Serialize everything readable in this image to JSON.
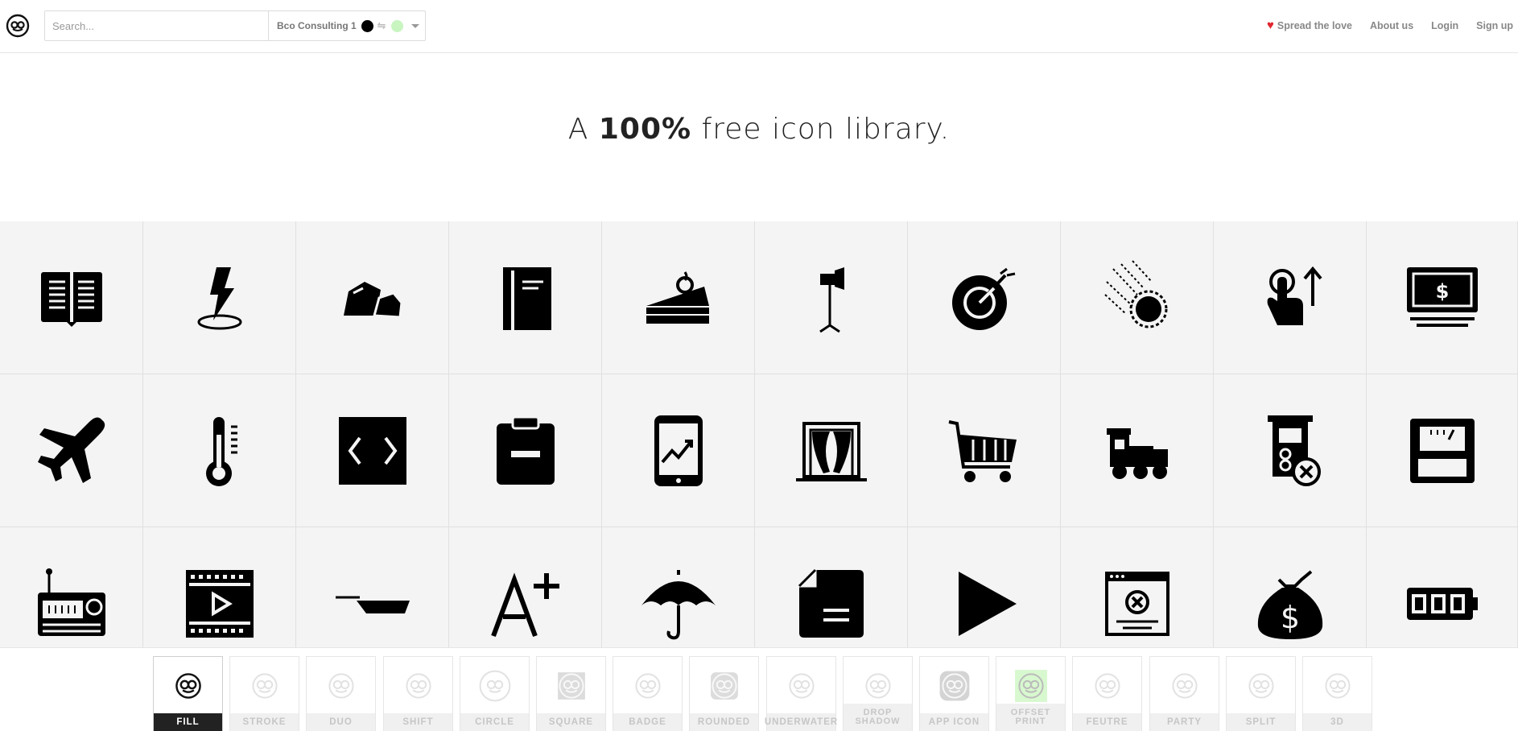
{
  "header": {
    "search_placeholder": "Search...",
    "collection_name": "Bco Consulting 1",
    "collection_colors": [
      "#000000",
      "#c8f5c0"
    ],
    "nav": {
      "spread_love": "Spread the love",
      "about": "About us",
      "login": "Login",
      "signup": "Sign up"
    }
  },
  "hero": {
    "prefix": "A ",
    "bold": "100%",
    "suffix": " free icon library."
  },
  "icons": [
    [
      "open-book-icon",
      "lightning-location-icon",
      "rocks-icon",
      "books-icon",
      "cake-slice-icon",
      "studio-light-icon",
      "target-icon",
      "meteor-icon",
      "swipe-up-icon",
      "banknote-icon"
    ],
    [
      "airplane-icon",
      "thermometer-icon",
      "code-icon",
      "clipboard-minus-icon",
      "mobile-chart-icon",
      "window-curtains-icon",
      "shopping-cart-icon",
      "toy-train-icon",
      "atm-error-icon",
      "floppy-disk-icon"
    ],
    [
      "radio-icon",
      "video-player-icon",
      "frying-pan-icon",
      "font-size-increase-icon",
      "umbrella-icon",
      "document-icon",
      "play-icon",
      "browser-error-icon",
      "money-bag-icon",
      "battery-full-icon"
    ]
  ],
  "styles": [
    {
      "label": "FILL",
      "active": true
    },
    {
      "label": "STROKE"
    },
    {
      "label": "DUO"
    },
    {
      "label": "SHIFT"
    },
    {
      "label": "CIRCLE"
    },
    {
      "label": "SQUARE"
    },
    {
      "label": "BADGE"
    },
    {
      "label": "ROUNDED"
    },
    {
      "label": "UNDERWATER"
    },
    {
      "label": "DROP SHADOW"
    },
    {
      "label": "APP ICON"
    },
    {
      "label": "OFFSET PRINT"
    },
    {
      "label": "FEUTRE"
    },
    {
      "label": "PARTY"
    },
    {
      "label": "SPLIT"
    },
    {
      "label": "3D"
    }
  ]
}
